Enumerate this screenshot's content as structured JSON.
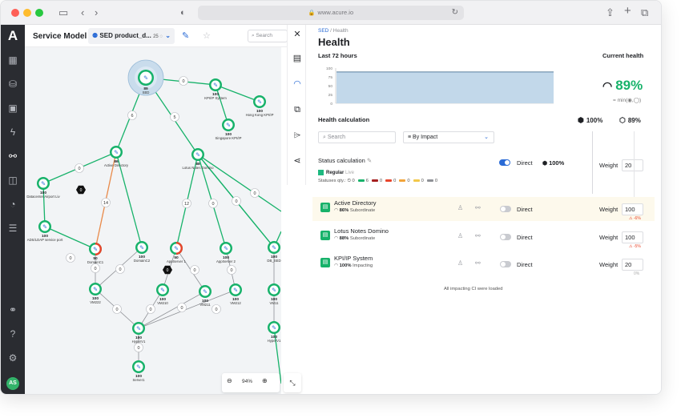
{
  "browser": {
    "url": "www.acure.io"
  },
  "app": {
    "logo": "A",
    "avatar_initials": "AS"
  },
  "graph_header": {
    "title": "Service Model",
    "selector_label": "SED product_d...",
    "selector_count": "25",
    "search_placeholder": "Search"
  },
  "graph": {
    "nodes": [
      {
        "id": "sed",
        "label": "SED",
        "value": "89",
        "status": "healthy-focus"
      },
      {
        "id": "kpip",
        "label": "KPI/IP System",
        "value": "100",
        "status": "healthy"
      },
      {
        "id": "hk",
        "label": "Hong Kong KPI/IP",
        "value": "100",
        "status": "healthy"
      },
      {
        "id": "sg",
        "label": "Singapore KPI/IP",
        "value": "100",
        "status": "healthy"
      },
      {
        "id": "ad",
        "label": "Active Directory",
        "value": "86",
        "status": "healthy"
      },
      {
        "id": "lnd",
        "label": "Lotus Notes Domino",
        "value": "88",
        "status": "healthy"
      },
      {
        "id": "dca",
        "label": "Datacenter Airport Liv",
        "value": "100",
        "status": "healthy"
      },
      {
        "id": "adsvc",
        "label": "ADS/LDAP service port",
        "value": "100",
        "status": "healthy"
      },
      {
        "id": "dc1",
        "label": "DomainC1",
        "value": "50",
        "status": "degraded"
      },
      {
        "id": "dc2",
        "label": "DomainC2",
        "value": "100",
        "status": "healthy"
      },
      {
        "id": "as1",
        "label": "AppServer 1",
        "value": "50",
        "status": "degraded"
      },
      {
        "id": "as2",
        "label": "AppServer 2",
        "value": "100",
        "status": "healthy"
      },
      {
        "id": "dbsed",
        "label": "DB_SED",
        "value": "100",
        "status": "healthy"
      },
      {
        "id": "vm222",
        "label": "VM222",
        "value": "100",
        "status": "healthy"
      },
      {
        "id": "vm210",
        "label": "VM210",
        "value": "100",
        "status": "healthy"
      },
      {
        "id": "vm211",
        "label": "VM211",
        "value": "100",
        "status": "healthy"
      },
      {
        "id": "vm212",
        "label": "VM212",
        "value": "100",
        "status": "healthy"
      },
      {
        "id": "vm11",
        "label": "VM11",
        "value": "100",
        "status": "healthy"
      },
      {
        "id": "hv1",
        "label": "HyperV1",
        "value": "100",
        "status": "healthy"
      },
      {
        "id": "hv1b",
        "label": "HyperV1",
        "value": "100",
        "status": "healthy"
      },
      {
        "id": "srv1",
        "label": "Server1",
        "value": "100",
        "status": "healthy"
      }
    ],
    "edge_weights": [
      "0",
      "6",
      "5",
      "0",
      "0",
      "14",
      "0",
      "12",
      "0",
      "0",
      "0",
      "0",
      "0",
      "0",
      "0",
      "0",
      "0",
      "0",
      "0",
      "0"
    ],
    "zoom_level": "94%"
  },
  "panel": {
    "breadcrumb_root": "SED",
    "breadcrumb_current": "Health",
    "title": "Health",
    "last72_label": "Last 72 hours",
    "current_health_label": "Current health",
    "current_health_value": "89%",
    "health_formula": "= min(◉,◯)",
    "chart_y_ticks": [
      "100",
      "75",
      "50",
      "25",
      "0"
    ],
    "chart_fill_color": "#c2d8ea",
    "chart_line_color": "#2b5b82",
    "health_calc_label": "Health calculation",
    "health_calc_stat1": "100%",
    "health_calc_stat2": "89%",
    "search_placeholder": "Search",
    "sort_label": "By Impact",
    "status_calc_label": "Status calculation",
    "direct_label": "Direct",
    "direct_value": "100%",
    "weight_label": "Weight",
    "status_weight": "20",
    "regular_label": "Regular",
    "live_label": "Live",
    "statuses_qty_label": "Statuses qty.:",
    "status_counts": [
      {
        "color": "#1e2024",
        "value": "0"
      },
      {
        "color": "#17b26a",
        "value": "6"
      },
      {
        "color": "#a51f1f",
        "value": "0"
      },
      {
        "color": "#e8452c",
        "value": "0"
      },
      {
        "color": "#f2a43a",
        "value": "0"
      },
      {
        "color": "#f2c84a",
        "value": "0"
      },
      {
        "color": "#8f9196",
        "value": "0"
      }
    ],
    "ci_rows": [
      {
        "name": "Active Directory",
        "health": "86%",
        "type": "Subordinate",
        "mode": "Direct",
        "weight": "100",
        "pct": "-6%",
        "highlight": true
      },
      {
        "name": "Lotus Notes Domino",
        "health": "88%",
        "type": "Subordinate",
        "mode": "Direct",
        "weight": "100",
        "pct": "-5%",
        "highlight": false
      },
      {
        "name": "KPI/IP System",
        "health": "100%",
        "type": "Impacting",
        "mode": "Direct",
        "weight": "20",
        "pct": "0%",
        "highlight": false
      }
    ],
    "loaded_message": "All impacting CI were loaded"
  }
}
